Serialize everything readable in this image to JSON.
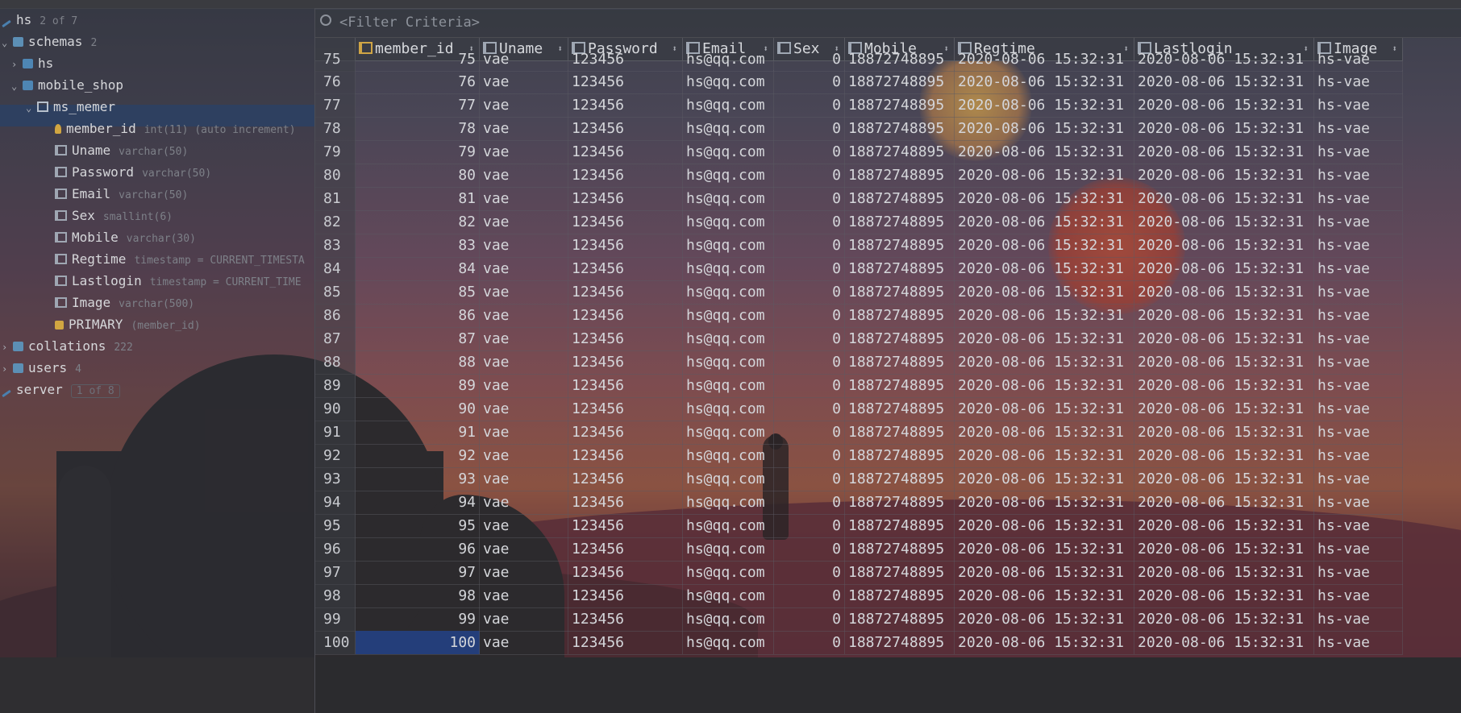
{
  "tree": {
    "root": {
      "label": "hs",
      "meta": "2 of 7"
    },
    "schemas": {
      "label": "schemas",
      "meta": "2"
    },
    "hs_schema": {
      "label": "hs"
    },
    "mobile_shop": {
      "label": "mobile_shop"
    },
    "table": {
      "label": "ms_memer"
    },
    "columns": [
      {
        "name": "member_id",
        "type": "int(11) (auto increment)"
      },
      {
        "name": "Uname",
        "type": "varchar(50)"
      },
      {
        "name": "Password",
        "type": "varchar(50)"
      },
      {
        "name": "Email",
        "type": "varchar(50)"
      },
      {
        "name": "Sex",
        "type": "smallint(6)"
      },
      {
        "name": "Mobile",
        "type": "varchar(30)"
      },
      {
        "name": "Regtime",
        "type": "timestamp = CURRENT_TIMESTA"
      },
      {
        "name": "Lastlogin",
        "type": "timestamp = CURRENT_TIME"
      },
      {
        "name": "Image",
        "type": "varchar(500)"
      }
    ],
    "primary": {
      "name": "PRIMARY",
      "meta": "(member_id)"
    },
    "collations": {
      "label": "collations",
      "meta": "222"
    },
    "users": {
      "label": "users",
      "meta": "4"
    },
    "server": {
      "label": "server",
      "meta": "1 of 8"
    }
  },
  "filter": {
    "placeholder": "<Filter Criteria>"
  },
  "grid": {
    "headers": [
      "member_id",
      "Uname",
      "Password",
      "Email",
      "Sex",
      "Mobile",
      "Regtime",
      "Lastlogin",
      "Image"
    ],
    "partial_row": {
      "rownum": "75",
      "member_id": "75",
      "uname": "vae",
      "password": "123456",
      "email": "hs@qq.com",
      "sex": "0",
      "mobile": "18872748895",
      "regtime": "2020-08-06 15:32:31",
      "lastlogin": "2020-08-06 15:32:31",
      "image": "hs-vae"
    },
    "rows": [
      {
        "rownum": "76",
        "member_id": "76",
        "uname": "vae",
        "password": "123456",
        "email": "hs@qq.com",
        "sex": "0",
        "mobile": "18872748895",
        "regtime": "2020-08-06 15:32:31",
        "lastlogin": "2020-08-06 15:32:31",
        "image": "hs-vae"
      },
      {
        "rownum": "77",
        "member_id": "77",
        "uname": "vae",
        "password": "123456",
        "email": "hs@qq.com",
        "sex": "0",
        "mobile": "18872748895",
        "regtime": "2020-08-06 15:32:31",
        "lastlogin": "2020-08-06 15:32:31",
        "image": "hs-vae"
      },
      {
        "rownum": "78",
        "member_id": "78",
        "uname": "vae",
        "password": "123456",
        "email": "hs@qq.com",
        "sex": "0",
        "mobile": "18872748895",
        "regtime": "2020-08-06 15:32:31",
        "lastlogin": "2020-08-06 15:32:31",
        "image": "hs-vae"
      },
      {
        "rownum": "79",
        "member_id": "79",
        "uname": "vae",
        "password": "123456",
        "email": "hs@qq.com",
        "sex": "0",
        "mobile": "18872748895",
        "regtime": "2020-08-06 15:32:31",
        "lastlogin": "2020-08-06 15:32:31",
        "image": "hs-vae"
      },
      {
        "rownum": "80",
        "member_id": "80",
        "uname": "vae",
        "password": "123456",
        "email": "hs@qq.com",
        "sex": "0",
        "mobile": "18872748895",
        "regtime": "2020-08-06 15:32:31",
        "lastlogin": "2020-08-06 15:32:31",
        "image": "hs-vae"
      },
      {
        "rownum": "81",
        "member_id": "81",
        "uname": "vae",
        "password": "123456",
        "email": "hs@qq.com",
        "sex": "0",
        "mobile": "18872748895",
        "regtime": "2020-08-06 15:32:31",
        "lastlogin": "2020-08-06 15:32:31",
        "image": "hs-vae"
      },
      {
        "rownum": "82",
        "member_id": "82",
        "uname": "vae",
        "password": "123456",
        "email": "hs@qq.com",
        "sex": "0",
        "mobile": "18872748895",
        "regtime": "2020-08-06 15:32:31",
        "lastlogin": "2020-08-06 15:32:31",
        "image": "hs-vae"
      },
      {
        "rownum": "83",
        "member_id": "83",
        "uname": "vae",
        "password": "123456",
        "email": "hs@qq.com",
        "sex": "0",
        "mobile": "18872748895",
        "regtime": "2020-08-06 15:32:31",
        "lastlogin": "2020-08-06 15:32:31",
        "image": "hs-vae"
      },
      {
        "rownum": "84",
        "member_id": "84",
        "uname": "vae",
        "password": "123456",
        "email": "hs@qq.com",
        "sex": "0",
        "mobile": "18872748895",
        "regtime": "2020-08-06 15:32:31",
        "lastlogin": "2020-08-06 15:32:31",
        "image": "hs-vae"
      },
      {
        "rownum": "85",
        "member_id": "85",
        "uname": "vae",
        "password": "123456",
        "email": "hs@qq.com",
        "sex": "0",
        "mobile": "18872748895",
        "regtime": "2020-08-06 15:32:31",
        "lastlogin": "2020-08-06 15:32:31",
        "image": "hs-vae"
      },
      {
        "rownum": "86",
        "member_id": "86",
        "uname": "vae",
        "password": "123456",
        "email": "hs@qq.com",
        "sex": "0",
        "mobile": "18872748895",
        "regtime": "2020-08-06 15:32:31",
        "lastlogin": "2020-08-06 15:32:31",
        "image": "hs-vae"
      },
      {
        "rownum": "87",
        "member_id": "87",
        "uname": "vae",
        "password": "123456",
        "email": "hs@qq.com",
        "sex": "0",
        "mobile": "18872748895",
        "regtime": "2020-08-06 15:32:31",
        "lastlogin": "2020-08-06 15:32:31",
        "image": "hs-vae"
      },
      {
        "rownum": "88",
        "member_id": "88",
        "uname": "vae",
        "password": "123456",
        "email": "hs@qq.com",
        "sex": "0",
        "mobile": "18872748895",
        "regtime": "2020-08-06 15:32:31",
        "lastlogin": "2020-08-06 15:32:31",
        "image": "hs-vae"
      },
      {
        "rownum": "89",
        "member_id": "89",
        "uname": "vae",
        "password": "123456",
        "email": "hs@qq.com",
        "sex": "0",
        "mobile": "18872748895",
        "regtime": "2020-08-06 15:32:31",
        "lastlogin": "2020-08-06 15:32:31",
        "image": "hs-vae"
      },
      {
        "rownum": "90",
        "member_id": "90",
        "uname": "vae",
        "password": "123456",
        "email": "hs@qq.com",
        "sex": "0",
        "mobile": "18872748895",
        "regtime": "2020-08-06 15:32:31",
        "lastlogin": "2020-08-06 15:32:31",
        "image": "hs-vae"
      },
      {
        "rownum": "91",
        "member_id": "91",
        "uname": "vae",
        "password": "123456",
        "email": "hs@qq.com",
        "sex": "0",
        "mobile": "18872748895",
        "regtime": "2020-08-06 15:32:31",
        "lastlogin": "2020-08-06 15:32:31",
        "image": "hs-vae"
      },
      {
        "rownum": "92",
        "member_id": "92",
        "uname": "vae",
        "password": "123456",
        "email": "hs@qq.com",
        "sex": "0",
        "mobile": "18872748895",
        "regtime": "2020-08-06 15:32:31",
        "lastlogin": "2020-08-06 15:32:31",
        "image": "hs-vae"
      },
      {
        "rownum": "93",
        "member_id": "93",
        "uname": "vae",
        "password": "123456",
        "email": "hs@qq.com",
        "sex": "0",
        "mobile": "18872748895",
        "regtime": "2020-08-06 15:32:31",
        "lastlogin": "2020-08-06 15:32:31",
        "image": "hs-vae"
      },
      {
        "rownum": "94",
        "member_id": "94",
        "uname": "vae",
        "password": "123456",
        "email": "hs@qq.com",
        "sex": "0",
        "mobile": "18872748895",
        "regtime": "2020-08-06 15:32:31",
        "lastlogin": "2020-08-06 15:32:31",
        "image": "hs-vae"
      },
      {
        "rownum": "95",
        "member_id": "95",
        "uname": "vae",
        "password": "123456",
        "email": "hs@qq.com",
        "sex": "0",
        "mobile": "18872748895",
        "regtime": "2020-08-06 15:32:31",
        "lastlogin": "2020-08-06 15:32:31",
        "image": "hs-vae"
      },
      {
        "rownum": "96",
        "member_id": "96",
        "uname": "vae",
        "password": "123456",
        "email": "hs@qq.com",
        "sex": "0",
        "mobile": "18872748895",
        "regtime": "2020-08-06 15:32:31",
        "lastlogin": "2020-08-06 15:32:31",
        "image": "hs-vae"
      },
      {
        "rownum": "97",
        "member_id": "97",
        "uname": "vae",
        "password": "123456",
        "email": "hs@qq.com",
        "sex": "0",
        "mobile": "18872748895",
        "regtime": "2020-08-06 15:32:31",
        "lastlogin": "2020-08-06 15:32:31",
        "image": "hs-vae"
      },
      {
        "rownum": "98",
        "member_id": "98",
        "uname": "vae",
        "password": "123456",
        "email": "hs@qq.com",
        "sex": "0",
        "mobile": "18872748895",
        "regtime": "2020-08-06 15:32:31",
        "lastlogin": "2020-08-06 15:32:31",
        "image": "hs-vae"
      },
      {
        "rownum": "99",
        "member_id": "99",
        "uname": "vae",
        "password": "123456",
        "email": "hs@qq.com",
        "sex": "0",
        "mobile": "18872748895",
        "regtime": "2020-08-06 15:32:31",
        "lastlogin": "2020-08-06 15:32:31",
        "image": "hs-vae"
      },
      {
        "rownum": "100",
        "member_id": "100",
        "uname": "vae",
        "password": "123456",
        "email": "hs@qq.com",
        "sex": "0",
        "mobile": "18872748895",
        "regtime": "2020-08-06 15:32:31",
        "lastlogin": "2020-08-06 15:32:31",
        "image": "hs-vae"
      }
    ],
    "selected_row": "100"
  },
  "colors": {
    "selection": "#2e4060",
    "cell_selection": "#243e7a",
    "accent_key": "#d1a641",
    "schema_icon": "#4e86b4"
  }
}
